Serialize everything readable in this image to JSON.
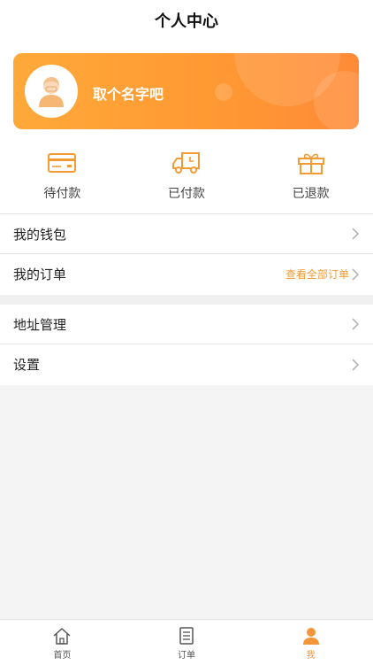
{
  "header": {
    "title": "个人中心"
  },
  "profile": {
    "name": "取个名字吧",
    "avatar_icon": "user-avatar-icon"
  },
  "status": [
    {
      "label": "待付款",
      "icon": "card-icon"
    },
    {
      "label": "已付款",
      "icon": "truck-icon"
    },
    {
      "label": "已退款",
      "icon": "gift-icon"
    }
  ],
  "menu": {
    "wallet": "我的钱包",
    "orders": "我的订单",
    "orders_extra": "查看全部订单",
    "address": "地址管理",
    "settings": "设置"
  },
  "tabbar": [
    {
      "label": "首页",
      "icon": "home-icon"
    },
    {
      "label": "订单",
      "icon": "list-icon"
    },
    {
      "label": "我",
      "icon": "user-icon",
      "active": true
    }
  ],
  "colors": {
    "accent": "#f3963a",
    "card_start": "#ffa93a",
    "card_end": "#ff8a37"
  }
}
